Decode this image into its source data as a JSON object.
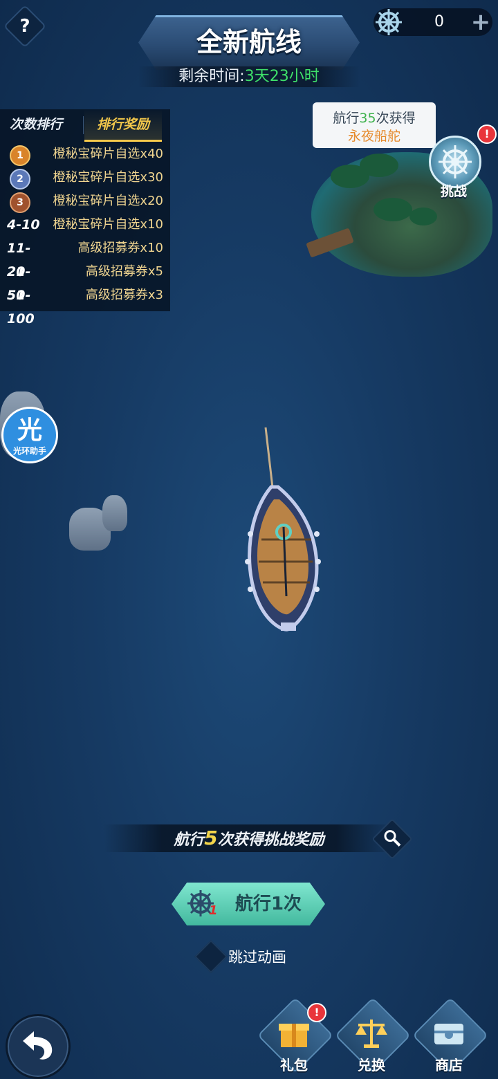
{
  "header": {
    "help_label": "?",
    "title": "全新航线",
    "timer_label": "剩余时间:",
    "timer_value": "3天23小时",
    "currency_amount": "0",
    "currency_icon": "ship-wheel-icon",
    "plus_label": "+"
  },
  "ranking": {
    "tab_count": "次数排行",
    "tab_rewards": "排行奖励",
    "rows": [
      {
        "rank": "1",
        "reward": "橙秘宝碎片自选x40"
      },
      {
        "rank": "2",
        "reward": "橙秘宝碎片自选x30"
      },
      {
        "rank": "3",
        "reward": "橙秘宝碎片自选x20"
      },
      {
        "rank": "4-10",
        "reward": "橙秘宝碎片自选x10"
      },
      {
        "rank": "11-20",
        "reward": "高级招募券x10"
      },
      {
        "rank": "21-50",
        "reward": "高级招募券x5"
      },
      {
        "rank": "51-100",
        "reward": "高级招募券x3"
      }
    ]
  },
  "island": {
    "bubble_prefix": "航行",
    "bubble_count": "35",
    "bubble_suffix": "次获得",
    "bubble_reward": "永夜船舵",
    "challenge_label": "挑战",
    "alert_mark": "!"
  },
  "assistant": {
    "big": "光",
    "small": "光环助手"
  },
  "mission": {
    "prefix": "航行",
    "count": "5",
    "suffix": "次获得挑战奖励"
  },
  "actions": {
    "sail_label": "航行1次",
    "sail_badge": "1",
    "skip_label": "跳过动画"
  },
  "bottom_nav": {
    "gift": "礼包",
    "exchange": "兑换",
    "shop": "商店",
    "gift_alert": "!"
  },
  "colors": {
    "accent_green": "#3fe06a",
    "gold": "#f3c84b",
    "teal_button": "#43b99e",
    "alert_red": "#e9353b"
  }
}
